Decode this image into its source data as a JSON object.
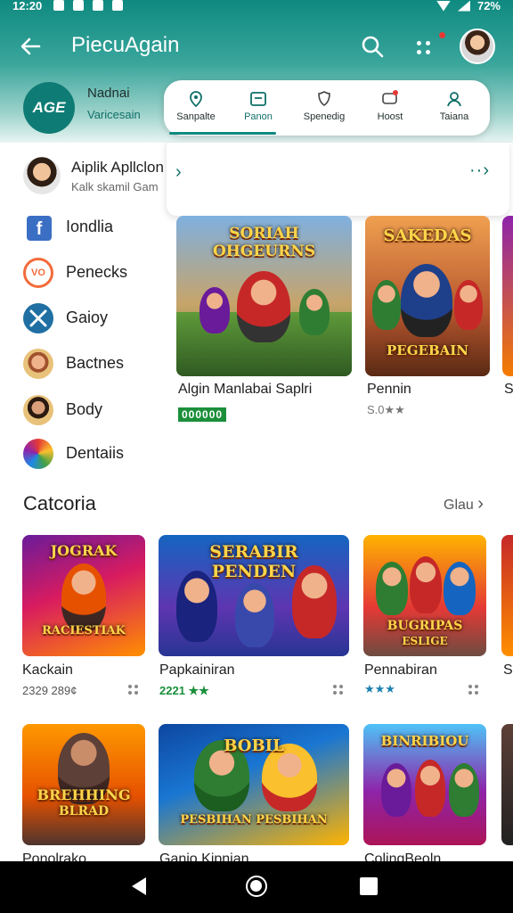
{
  "status_bar": {
    "time": "12:20",
    "battery": "72%"
  },
  "app_bar": {
    "title": "PiecuAgain"
  },
  "brand": {
    "logo_text": "AGE",
    "name": "Nadnai",
    "subtitle": "Varicesain"
  },
  "tabs": [
    {
      "label": "Sanpalte"
    },
    {
      "label": "Panon"
    },
    {
      "label": "Spenedig"
    },
    {
      "label": "Hoost"
    },
    {
      "label": "Taiana"
    }
  ],
  "drawer": {
    "user_name": "Aiplik Apllclon",
    "user_sub": "Kalk skamil Gam",
    "items": [
      {
        "label": "Iondlia",
        "icon": "facebook-icon",
        "color": "#3b6fc4"
      },
      {
        "label": "Penecks",
        "icon": "vo-logo-icon",
        "color": "#f26b3a"
      },
      {
        "label": "Gaioy",
        "icon": "crossed-swords-icon",
        "color": "#1f6fa3"
      },
      {
        "label": "Bactnes",
        "icon": "character-icon",
        "color": "#e8c27a"
      },
      {
        "label": "Body",
        "icon": "person-icon",
        "color": "#e8c27a"
      },
      {
        "label": "Dentaiis",
        "icon": "rainbow-icon",
        "color": "#7d3fa8"
      }
    ]
  },
  "featured": [
    {
      "art_text": "SORIAH OHGEURNS",
      "title": "Algin Manlabai Saplri",
      "badge": "000000"
    },
    {
      "art_text": "SAKEDAS",
      "art_text2": "PEGEBAIN",
      "title": "Pennin",
      "sub": "S.0★★"
    }
  ],
  "category": {
    "title": "Catcoria",
    "see_all": "Glau",
    "games_row1": [
      {
        "art_text": "JOGRAK",
        "art_text2": "RACIESTIAK",
        "name": "Kackain",
        "rating": "2329 289¢"
      },
      {
        "art_text": "SERABIR",
        "art_text2": "PENDEN",
        "name": "Papkainiran",
        "rating": "2221 ★★"
      },
      {
        "art_text": "BUGRIPAS",
        "art_text2": "ESLIGE",
        "name": "Pennabiran",
        "rating": "★★★"
      }
    ],
    "games_row2": [
      {
        "art_text": "BREHHING",
        "art_text2": "BLRAD",
        "name": "Ponolrako"
      },
      {
        "art_text": "BOBIL",
        "art_text2": "PESBIHAN PESBIHAN",
        "name": "Ganio Kipnian"
      },
      {
        "art_text": "BINRIBIOU",
        "name": "ColingBeoln"
      }
    ]
  }
}
